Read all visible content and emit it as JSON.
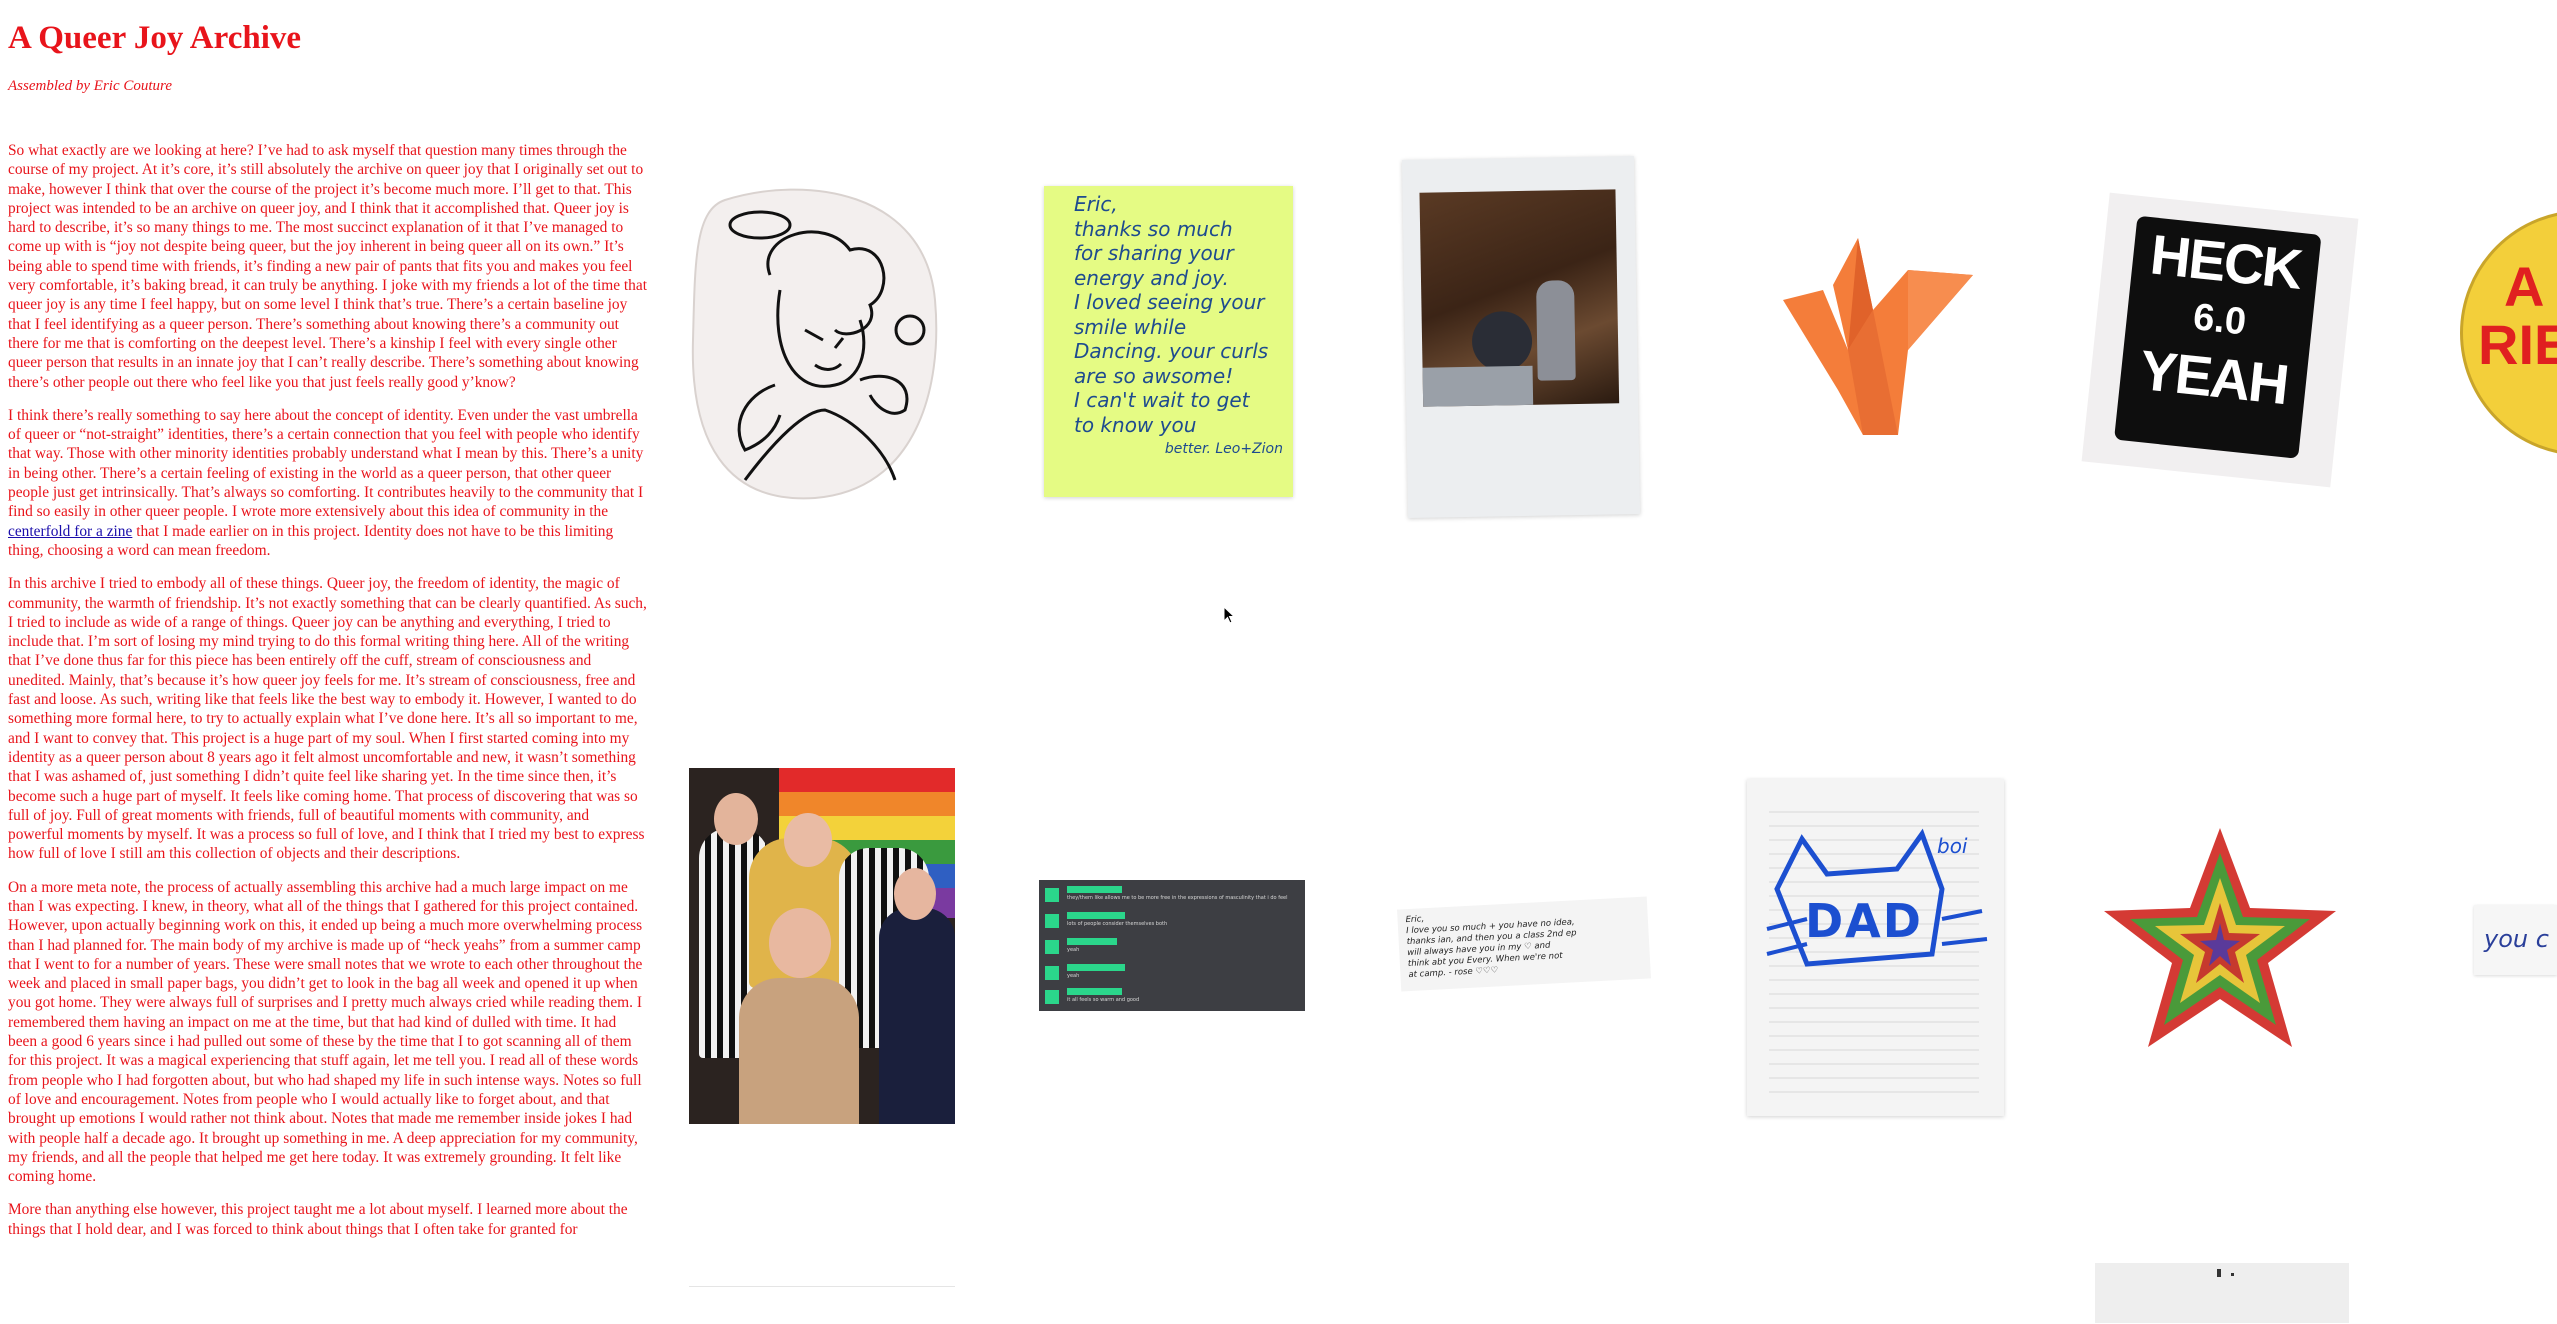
{
  "page": {
    "title": "A Queer Joy Archive",
    "byline": "Assembled by Eric Couture"
  },
  "paragraphs": [
    {
      "text": "So what exactly are we looking at here? I’ve had to ask myself that question many times through the course of my project. At it’s core, it’s still absolutely the archive on queer joy that I originally set out to make, however I think that over the course of the project it’s become much more. I’ll get to that. This project was intended to be an archive on queer joy, and I think that it accomplished that. Queer joy is hard to describe, it’s so many things to me. The most succinct explanation of it that I’ve managed to come up with is “joy not despite being queer, but the joy inherent in being queer all on its own.” It’s being able to spend time with friends, it’s finding a new pair of pants that fits you and makes you feel very comfortable, it’s baking bread, it can truly be anything. I joke with my friends a lot of the time that queer joy is any time I feel happy, but on some level I think that’s true. There’s a certain baseline joy that I feel identifying as a queer person. There’s something about knowing there’s a community out there for me that is comforting on the deepest level. There’s a kinship I feel with every single other queer person that results in an innate joy that I can’t really describe. There’s something about knowing there’s other people out there who feel like you that just feels really good y’know?"
    },
    {
      "before": "I think there’s really something to say here about the concept of identity. Even under the vast umbrella of queer or “not-straight” identities, there’s a certain connection that you feel with people who identify that way. Those with other minority identities probably understand what I mean by this. There’s a unity in being other. There’s a certain feeling of existing in the world as a queer person, that other queer people just get intrinsically. That’s always so comforting. It contributes heavily to the community that I find so easily in other queer people. I wrote more extensively about this idea of community in the ",
      "link": "centerfold for a zine",
      "after": " that I made earlier on in this project. Identity does not have to be this limiting thing, choosing a word can mean freedom."
    },
    {
      "text": "In this archive I tried to embody all of these things. Queer joy, the freedom of identity, the magic of community, the warmth of friendship. It’s not exactly something that can be clearly quantified. As such, I tried to include as wide of a range of things. Queer joy can be anything and everything, I tried to include that. I’m sort of losing my mind trying to do this formal writing thing here. All of the writing that I’ve done thus far for this piece has been entirely off the cuff, stream of consciousness and unedited. Mainly, that’s because it’s how queer joy feels for me. It’s stream of consciousness, free and fast and loose. As such, writing like that feels like the best way to embody it. However, I wanted to do something more formal here, to try to actually explain what I’ve done here. It’s all so important to me, and I want to convey that. This project is a huge part of my soul. When I first started coming into my identity as a queer person about 8 years ago it felt almost uncomfortable and new, it wasn’t something that I was ashamed of, just something I didn’t quite feel like sharing yet. In the time since then, it’s become such a huge part of myself. It feels like coming home. That process of discovering that was so full of joy. Full of great moments with friends, full of beautiful moments with community, and powerful moments by myself. It was a process so full of love, and I think that I tried my best to express how full of love I still am this collection of objects and their descriptions."
    },
    {
      "text": "On a more meta note, the process of actually assembling this archive had a much large impact on me than I was expecting. I knew, in theory, what all of the things that I gathered for this project contained. However, upon actually beginning work on this, it ended up being a much more overwhelming process than I had planned for. The main body of my archive is made up of “heck yeahs” from a summer camp that I went to for a number of years. These were small notes that we wrote to each other throughout the week and placed in small paper bags, you didn’t get to look in the bag all week and opened it up when you got home. They were always full of surprises and I pretty much always cried while reading them. I remembered them having an impact on me at the time, but that had kind of dulled with time. It had been a good 6 years since i had pulled out some of these by the time that I to got scanning all of them for this project. It was a magical experiencing that stuff again, let me tell you. I read all of these words from people who I had forgotten about, but who had shaped my life in such intense ways. Notes so full of love and encouragement. Notes from people who I would actually like to forget about, and that brought up emotions I would rather not think about. Notes that made me remember inside jokes I had with people half a decade ago. It brought up something in me. A deep appreciation for my community, my friends, and all the people that helped me get here today. It was extremely grounding. It felt like coming home."
    },
    {
      "text": "More than anything else however, this project taught me a lot about myself. I learned more about the things that I hold dear, and I was forced to think about things that I often take for granted for"
    }
  ],
  "gallery": {
    "angel": {
      "alt": "angel drawing"
    },
    "sticky_note": {
      "lines": [
        "Eric,",
        "thanks so much",
        "for sharing your",
        "energy and joy.",
        "I loved seeing your",
        "smile while",
        "Dancing. your curls",
        "are so awsome!",
        "I can't wait to get",
        "to know you",
        "better. Leo+Zion"
      ]
    },
    "polaroid": {
      "alt": "polaroid photo"
    },
    "crane": {
      "alt": "orange origami crane"
    },
    "heck_yeah": {
      "lines": [
        "HECK",
        "6.0",
        "YEAH"
      ]
    },
    "button": {
      "lines": [
        "A",
        "RIE"
      ]
    },
    "group_photo": {
      "alt": "group photo"
    },
    "poll": {
      "rows": [
        {
          "label": "they/them like allows me to be more free in the expressions of masculinity that i do feel"
        },
        {
          "label": "lots of people consider themselves both"
        },
        {
          "label": "yeah"
        },
        {
          "label": "yeah"
        },
        {
          "label": "it all feels so warm and good"
        }
      ]
    },
    "strip_note": {
      "lines": [
        "Eric,",
        "I love you so much + you have no idea,",
        "thanks ian, and then you a class 2nd ep",
        "will always have you in my ♡ and",
        "think abt you Every. When we're not",
        "at camp. - rose ♡♡♡"
      ]
    },
    "dad_drawing": {
      "label": "boi",
      "text": "DAD"
    },
    "star": {
      "alt": "rainbow star sticker"
    },
    "scrap": {
      "text": "you c"
    }
  }
}
